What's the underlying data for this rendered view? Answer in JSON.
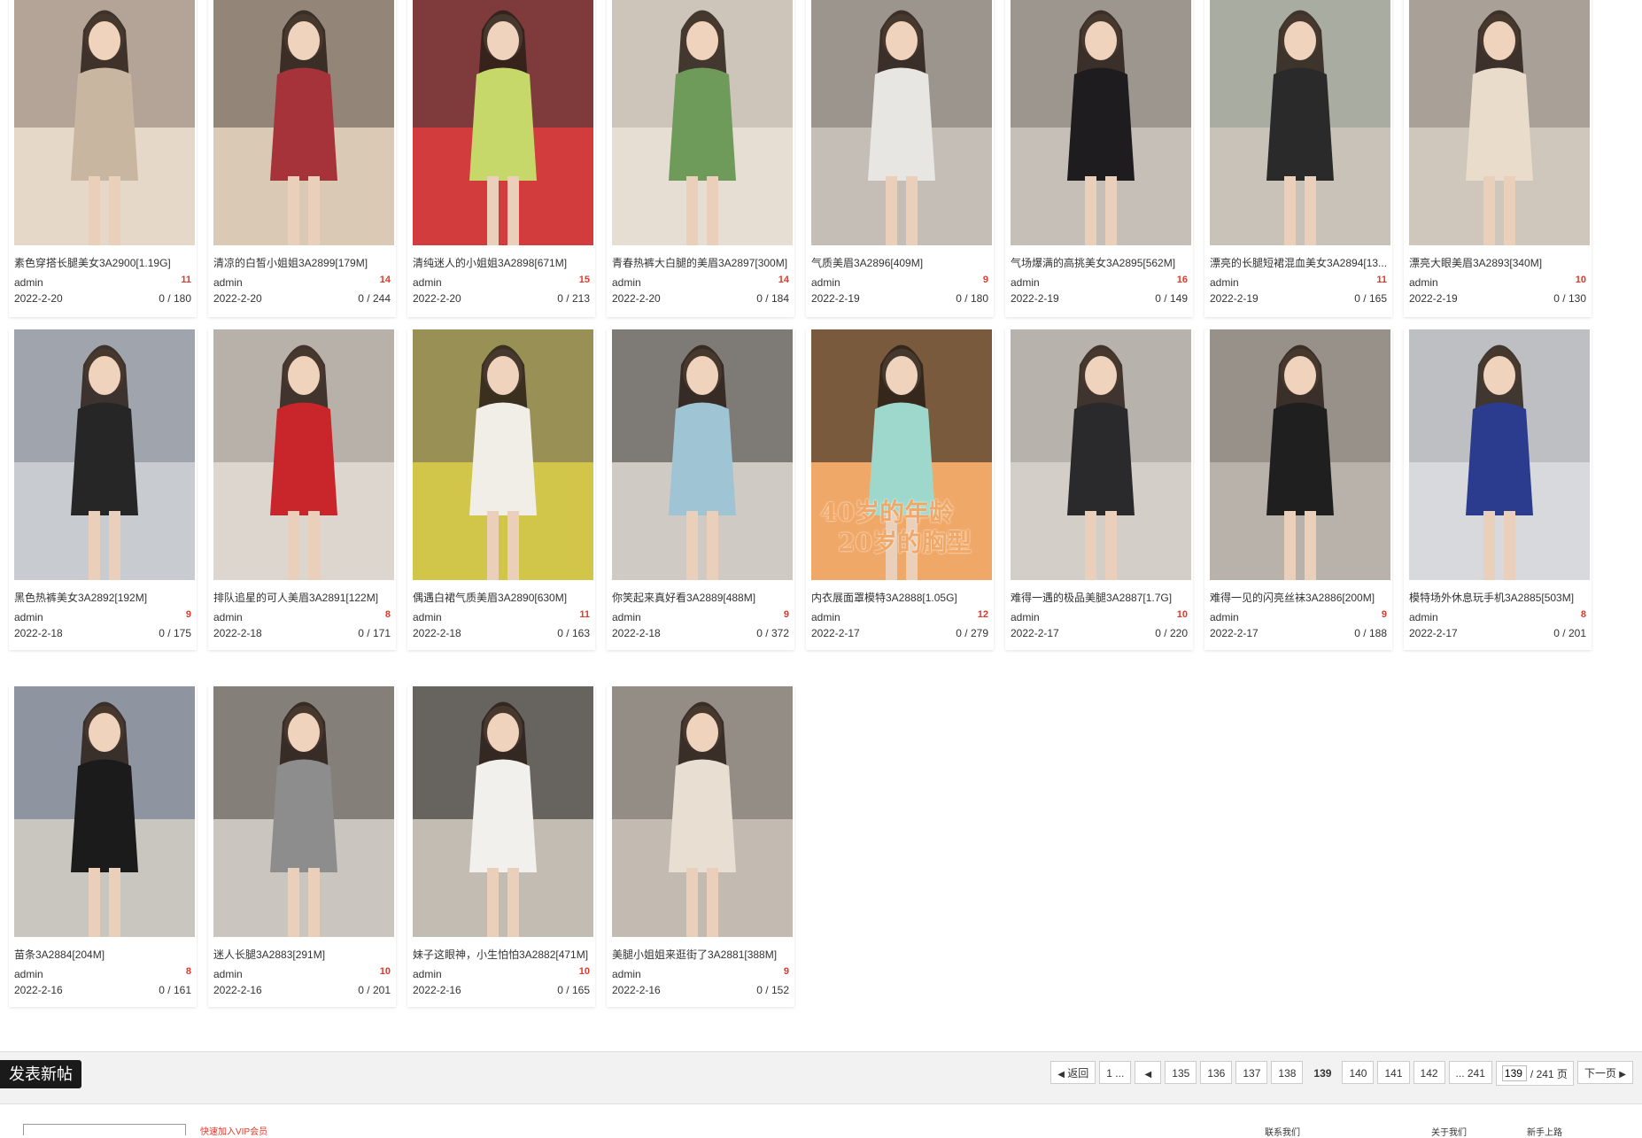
{
  "cards": [
    {
      "title": "素色穿搭长腿美女3A2900[1.19G]",
      "author": "admin",
      "count": "11",
      "date": "2022-2-20",
      "views": "0 / 180",
      "c1": "#c9b6a0",
      "c2": "#8a7a70",
      "c3": "#e6d8c8"
    },
    {
      "title": "清凉的白皙小姐姐3A2899[179M]",
      "author": "admin",
      "count": "14",
      "date": "2022-2-20",
      "views": "0 / 244",
      "c1": "#a6333a",
      "c2": "#5a4e45",
      "c3": "#d9c9b5"
    },
    {
      "title": "清纯迷人的小姐姐3A2898[671M]",
      "author": "admin",
      "count": "15",
      "date": "2022-2-20",
      "views": "0 / 213",
      "c1": "#c7d86a",
      "c2": "#3a3a3a",
      "c3": "#d23c3c"
    },
    {
      "title": "青春热裤大白腿的美眉3A2897[300M]",
      "author": "admin",
      "count": "14",
      "date": "2022-2-20",
      "views": "0 / 184",
      "c1": "#6e9a5a",
      "c2": "#b8b0a5",
      "c3": "#e6ded2"
    },
    {
      "title": "气质美眉3A2896[409M]",
      "author": "admin",
      "count": "9",
      "date": "2022-2-19",
      "views": "0 / 180",
      "c1": "#e8e6e2",
      "c2": "#7a736c",
      "c3": "#c4beb6"
    },
    {
      "title": "气场爆满的高挑美女3A2895[562M]",
      "author": "admin",
      "count": "16",
      "date": "2022-2-19",
      "views": "0 / 149",
      "c1": "#1e1c1e",
      "c2": "#7a746e",
      "c3": "#c6bfb7"
    },
    {
      "title": "漂亮的长腿短裙混血美女3A2894[13...",
      "author": "admin",
      "count": "11",
      "date": "2022-2-19",
      "views": "0 / 165",
      "c1": "#2a2a2a",
      "c2": "#8f9a8e",
      "c3": "#c8c2b8"
    },
    {
      "title": "漂亮大眼美眉3A2893[340M]",
      "author": "admin",
      "count": "10",
      "date": "2022-2-19",
      "views": "0 / 130",
      "c1": "#e9dccb",
      "c2": "#8a8278",
      "c3": "#cfc6bc"
    },
    {
      "title": "黑色热裤美女3A2892[192M]",
      "author": "admin",
      "count": "9",
      "date": "2022-2-18",
      "views": "0 / 175",
      "c1": "#262626",
      "c2": "#7f8790",
      "c3": "#c8cbd0"
    },
    {
      "title": "排队追星的可人美眉3A2891[122M]",
      "author": "admin",
      "count": "8",
      "date": "2022-2-18",
      "views": "0 / 171",
      "c1": "#c8262b",
      "c2": "#9a948c",
      "c3": "#dcd6cf"
    },
    {
      "title": "偶遇白裙气质美眉3A2890[630M]",
      "author": "admin",
      "count": "11",
      "date": "2022-2-18",
      "views": "0 / 163",
      "c1": "#f1eee8",
      "c2": "#6a645e",
      "c3": "#d1c54a"
    },
    {
      "title": "你笑起来真好看3A2889[488M]",
      "author": "admin",
      "count": "9",
      "date": "2022-2-18",
      "views": "0 / 372",
      "c1": "#9fc4d4",
      "c2": "#3c3835",
      "c3": "#cfcac4"
    },
    {
      "title": "内衣展面罩模特3A2888[1.05G]",
      "author": "admin",
      "count": "12",
      "date": "2022-2-17",
      "views": "0 / 279",
      "c1": "#9ed8cc",
      "c2": "#1a1a1a",
      "c3": "#f0a868"
    },
    {
      "title": "难得一遇的极品美腿3A2887[1.7G]",
      "author": "admin",
      "count": "10",
      "date": "2022-2-17",
      "views": "0 / 220",
      "c1": "#2a2a2c",
      "c2": "#a09a95",
      "c3": "#d4cec8"
    },
    {
      "title": "难得一见的闪亮丝袜3A2886[200M]",
      "author": "admin",
      "count": "9",
      "date": "2022-2-17",
      "views": "0 / 188",
      "c1": "#1f1f1f",
      "c2": "#7d776f",
      "c3": "#b9b2aa"
    },
    {
      "title": "模特场外休息玩手机3A2885[503M]",
      "author": "admin",
      "count": "8",
      "date": "2022-2-17",
      "views": "0 / 201",
      "c1": "#2b3c8e",
      "c2": "#a8a9ad",
      "c3": "#d8d9dc"
    },
    {
      "title": "苗条3A2884[204M]",
      "author": "admin",
      "count": "8",
      "date": "2022-2-16",
      "views": "0 / 161",
      "c1": "#1b1b1b",
      "c2": "#5e6c86",
      "c3": "#c9c6c0"
    },
    {
      "title": "迷人长腿3A2883[291M]",
      "author": "admin",
      "count": "10",
      "date": "2022-2-16",
      "views": "0 / 201",
      "c1": "#8d8d8d",
      "c2": "#4b4540",
      "c3": "#cbc5bf"
    },
    {
      "title": "妹子这眼神，小生怕怕3A2882[471M]",
      "author": "admin",
      "count": "10",
      "date": "2022-2-16",
      "views": "0 / 165",
      "c1": "#f2f0ec",
      "c2": "#1c1c1c",
      "c3": "#c3bcb3"
    },
    {
      "title": "美腿小姐姐来逛街了3A2881[388M]",
      "author": "admin",
      "count": "9",
      "date": "2022-2-16",
      "views": "0 / 152",
      "c1": "#e8dfd2",
      "c2": "#6d6862",
      "c3": "#c3bbb1"
    }
  ],
  "overlay_text": {
    "line1": "40岁的年龄",
    "line2": "20岁的胸型"
  },
  "new_post": "发表新帖",
  "pager": {
    "back": "返回",
    "first": "1 ...",
    "pages": [
      "135",
      "136",
      "137",
      "138",
      "139",
      "140",
      "141",
      "142"
    ],
    "current": "139",
    "last": "... 241",
    "input_value": "139",
    "total": "/ 241 页",
    "next": "下一页"
  },
  "bottom": {
    "vip": "快速加入VIP会员",
    "link1": "联系我们",
    "link2": "关于我们",
    "link3": "新手上路"
  }
}
